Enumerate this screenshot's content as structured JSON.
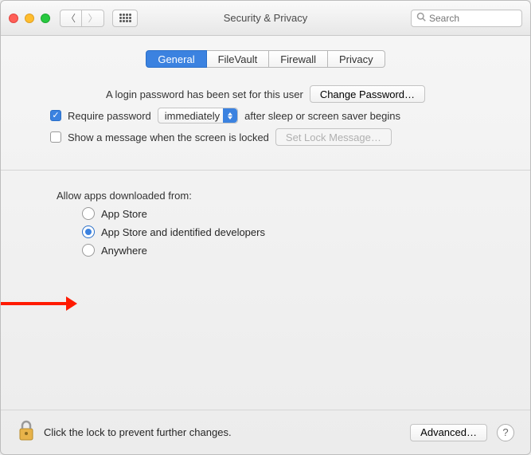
{
  "window": {
    "title": "Security & Privacy",
    "search_placeholder": "Search"
  },
  "tabs": {
    "general": "General",
    "filevault": "FileVault",
    "firewall": "Firewall",
    "privacy": "Privacy",
    "active": "general"
  },
  "password_section": {
    "login_text": "A login password has been set for this user",
    "change_button": "Change Password…",
    "require_label": "Require password",
    "require_checked": true,
    "delay_value": "immediately",
    "after_text": "after sleep or screen saver begins",
    "show_message_label": "Show a message when the screen is locked",
    "show_message_checked": false,
    "set_lock_button": "Set Lock Message…"
  },
  "gatekeeper": {
    "heading": "Allow apps downloaded from:",
    "options": [
      {
        "label": "App Store",
        "selected": false
      },
      {
        "label": "App Store and identified developers",
        "selected": true
      },
      {
        "label": "Anywhere",
        "selected": false
      }
    ]
  },
  "footer": {
    "lock_text": "Click the lock to prevent further changes.",
    "advanced_button": "Advanced…"
  },
  "annotation": {
    "arrow_target": "gatekeeper-option-appstore-and-identified-developers",
    "color": "#ff1a00"
  }
}
